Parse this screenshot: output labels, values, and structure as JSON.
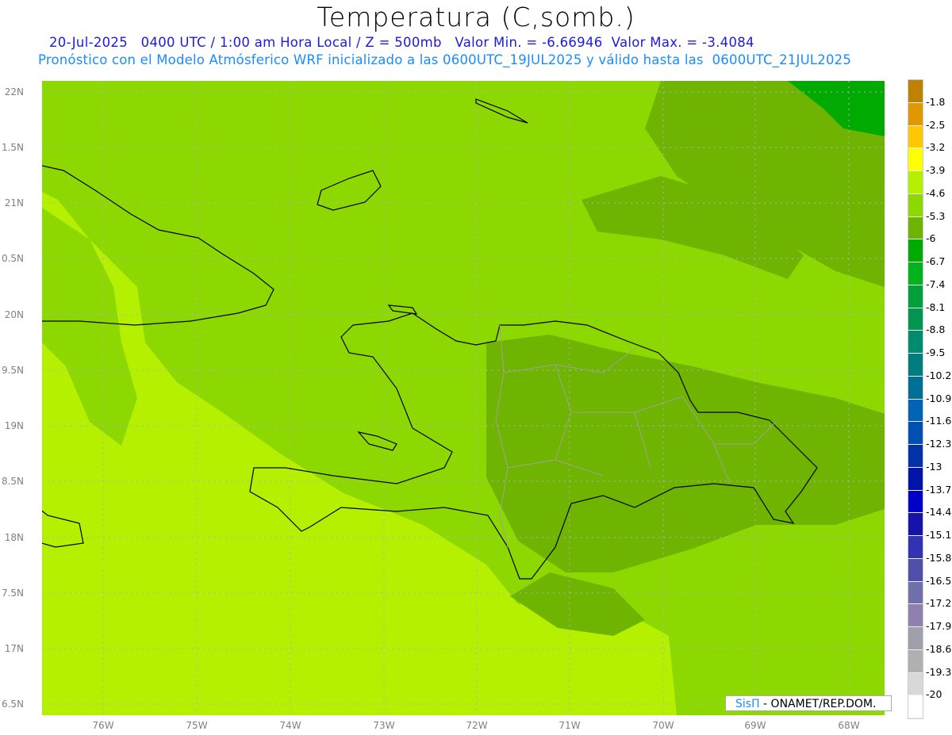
{
  "title": "Temperatura (C,somb.)",
  "subtitle_line1": "20-Jul-2025   0400 UTC / 1:00 am Hora Local / Z = 500mb   Valor Min. = -6.66946  Valor Max. = -3.4084",
  "subtitle_line2": "Pronóstico con el Modelo Atmósferico WRF inicializado a las 0600UTC_19JUL2025 y válido hasta las  0600UTC_21JUL2025",
  "lat_labels": [
    "22N",
    "1.5N",
    "21N",
    "0.5N",
    "20N",
    "9.5N",
    "19N",
    "8.5N",
    "18N",
    "7.5N",
    "17N",
    "6.5N"
  ],
  "lon_labels": [
    "76W",
    "75W",
    "74W",
    "73W",
    "72W",
    "71W",
    "70W",
    "69W",
    "68W"
  ],
  "colorbar": {
    "labels": [
      "-1.8",
      "-2.5",
      "-3.2",
      "-3.9",
      "-4.6",
      "-5.3",
      "-6",
      "-6.7",
      "-7.4",
      "-8.1",
      "-8.8",
      "-9.5",
      "-10.2",
      "-10.9",
      "-11.6",
      "-12.3",
      "-13",
      "-13.7",
      "-14.4",
      "-15.1",
      "-15.8",
      "-16.5",
      "-17.2",
      "-17.9",
      "-18.6",
      "-19.3",
      "-20"
    ],
    "colors": [
      "#c08000",
      "#e09800",
      "#ffc800",
      "#ffff00",
      "#b4f000",
      "#8cd800",
      "#6eb400",
      "#00aa00",
      "#00b41e",
      "#00a03c",
      "#009650",
      "#008c6e",
      "#007d7d",
      "#006e96",
      "#0064b4",
      "#0050b4",
      "#0032aa",
      "#0014aa",
      "#0000c8",
      "#1414aa",
      "#3232b4",
      "#5050aa",
      "#7070aa",
      "#9080b0",
      "#a0a0aa",
      "#b0b0b0",
      "#d8d8d8",
      "#ffffff"
    ]
  },
  "credit": {
    "brand": "SisΠ",
    "text": " - ONAMET/REP.DOM."
  }
}
